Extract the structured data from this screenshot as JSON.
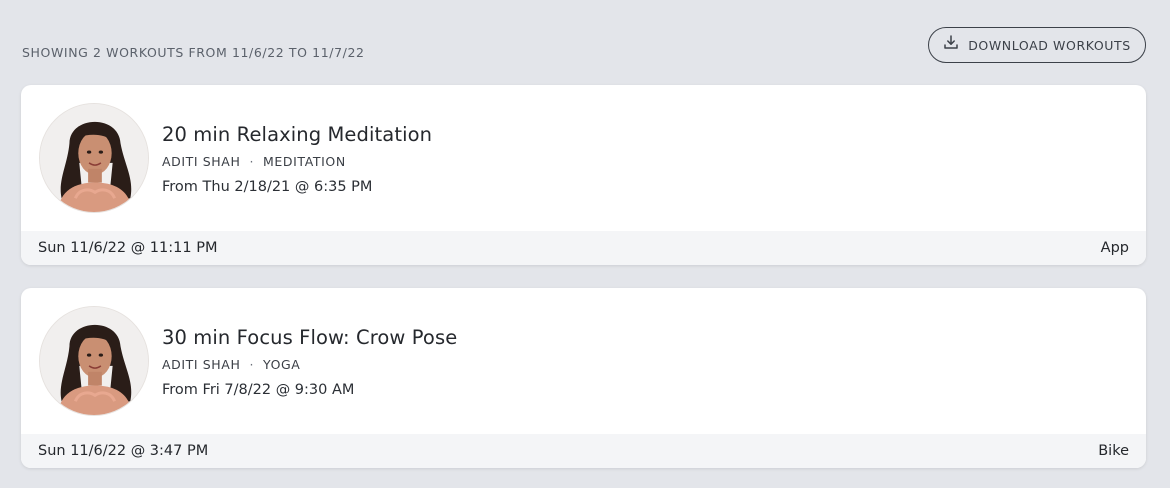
{
  "summary": "SHOWING 2 WORKOUTS FROM 11/6/22 TO 11/7/22",
  "download_button": {
    "label": "DOWNLOAD WORKOUTS",
    "icon": "download-icon"
  },
  "workouts": [
    {
      "title": "20 min Relaxing Meditation",
      "instructor": "ADITI SHAH",
      "separator": "·",
      "category": "MEDITATION",
      "from": "From Thu 2/18/21 @ 6:35 PM",
      "completed": "Sun 11/6/22 @ 11:11 PM",
      "platform": "App"
    },
    {
      "title": "30 min Focus Flow: Crow Pose",
      "instructor": "ADITI SHAH",
      "separator": "·",
      "category": "YOGA",
      "from": "From Fri 7/8/22 @ 9:30 AM",
      "completed": "Sun 11/6/22 @ 3:47 PM",
      "platform": "Bike"
    }
  ]
}
